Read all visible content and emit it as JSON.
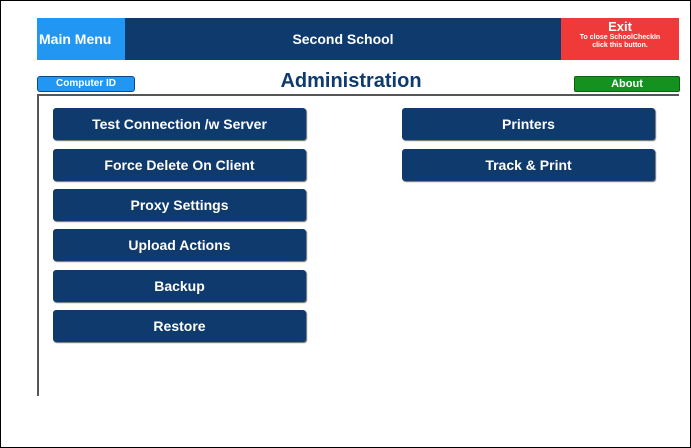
{
  "header": {
    "main_menu": "Main Menu",
    "school_name": "Second School",
    "exit_label": "Exit",
    "exit_hint_line1": "To close SchoolCheckIn",
    "exit_hint_line2": "click this button."
  },
  "subheader": {
    "computer_id": "Computer ID",
    "title": "Administration",
    "about": "About"
  },
  "buttons_left": [
    "Test Connection /w Server",
    "Force Delete On Client",
    "Proxy Settings",
    "Upload Actions",
    "Backup",
    "Restore"
  ],
  "buttons_right": [
    "Printers",
    "Track & Print"
  ],
  "colors": {
    "navy": "#0f3a6e",
    "blue": "#2196f3",
    "red": "#f03a3a",
    "green": "#15911f"
  }
}
